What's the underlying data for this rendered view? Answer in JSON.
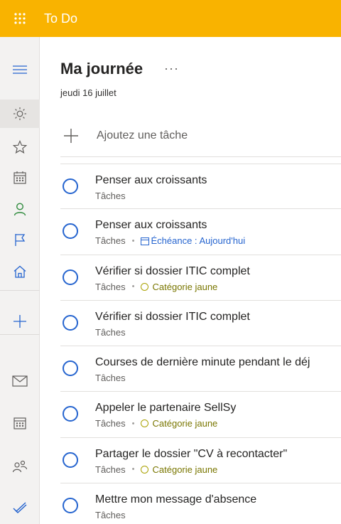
{
  "app": {
    "title": "To Do"
  },
  "colors": {
    "brand": "#f9b300",
    "accent": "#2564cf",
    "category_yellow": "#797600"
  },
  "rail": {
    "items": [
      {
        "icon": "hamburger-menu-icon"
      },
      {
        "icon": "sun-icon",
        "active": true
      },
      {
        "icon": "star-icon"
      },
      {
        "icon": "calendar-icon"
      },
      {
        "icon": "person-icon"
      },
      {
        "icon": "flag-icon"
      },
      {
        "icon": "home-icon"
      },
      {
        "icon": "plus-icon"
      },
      {
        "icon": "mail-icon"
      },
      {
        "icon": "calendar-app-icon"
      },
      {
        "icon": "people-icon"
      },
      {
        "icon": "todo-check-icon"
      }
    ]
  },
  "header": {
    "title": "Ma journée",
    "more": "···",
    "date": "jeudi 16 juillet"
  },
  "add_task": {
    "placeholder": "Ajoutez une tâche"
  },
  "tasks": [
    {
      "title": "Penser aux croissants",
      "list": "Tâches"
    },
    {
      "title": "Penser aux croissants",
      "list": "Tâches",
      "due": "Échéance : Aujourd'hui"
    },
    {
      "title": "Vérifier si dossier ITIC complet",
      "list": "Tâches",
      "category": "Catégorie jaune"
    },
    {
      "title": "Vérifier si dossier ITIC complet",
      "list": "Tâches"
    },
    {
      "title": "Courses de dernière minute pendant le déj",
      "list": "Tâches"
    },
    {
      "title": "Appeler le partenaire SellSy",
      "list": "Tâches",
      "category": "Catégorie jaune"
    },
    {
      "title": "Partager le dossier \"CV à recontacter\"",
      "list": "Tâches",
      "category": "Catégorie jaune"
    },
    {
      "title": "Mettre mon message d'absence",
      "list": "Tâches"
    }
  ]
}
